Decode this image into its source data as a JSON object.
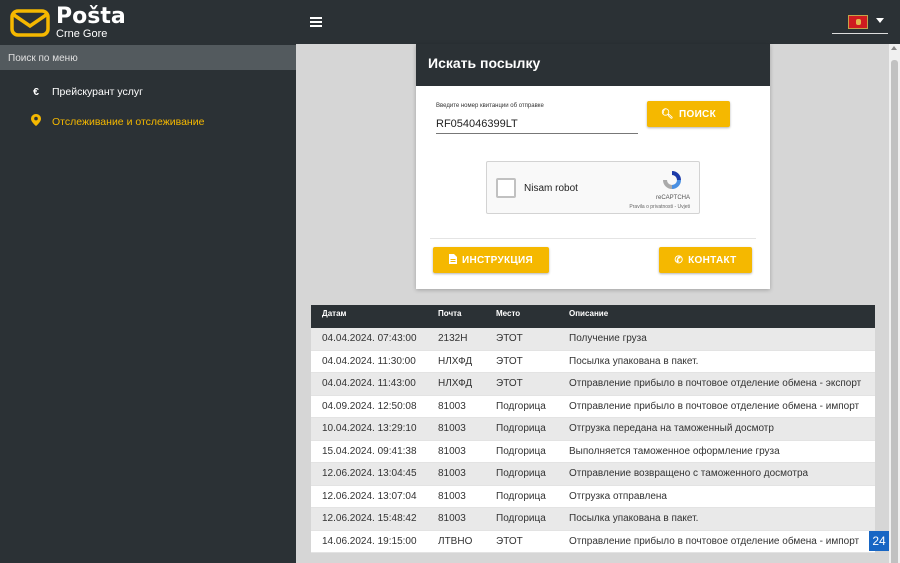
{
  "brand": {
    "title": "Pošta",
    "subtitle": "Crne Gore"
  },
  "sidebar": {
    "search_label": "Поиск по меню",
    "items": [
      {
        "label": "Прейскурант услуг",
        "icon": "euro-icon"
      },
      {
        "label": "Отслеживание и отслеживание",
        "icon": "location-pin-icon",
        "active": true
      }
    ]
  },
  "topbar": {
    "language": "flag-montenegro-icon"
  },
  "search": {
    "title": "Искать посылку",
    "field_label": "Введите номер квитанции об отправке",
    "tracking_number": "RF054046399LT",
    "search_button": "ПОИСК",
    "captcha_label": "Nisam robot",
    "captcha_brand": "reCAPTCHA",
    "captcha_links": "Pravila o privatnosti - Uvjeti",
    "instructions_button": "ИНСТРУКЦИЯ",
    "contact_button": "КОНТАКТ"
  },
  "table": {
    "headers": [
      "Датам",
      "Почта",
      "Место",
      "Описание"
    ],
    "rows": [
      [
        "04.04.2024. 07:43:00",
        "2132H",
        "ЭТОТ",
        "Получение груза"
      ],
      [
        "04.04.2024. 11:30:00",
        "НЛХФД",
        "ЭТОТ",
        "Посылка упакована в пакет."
      ],
      [
        "04.04.2024. 11:43:00",
        "НЛХФД",
        "ЭТОТ",
        "Отправление прибыло в почтовое отделение обмена - экспорт"
      ],
      [
        "04.09.2024. 12:50:08",
        "81003",
        "Подгорица",
        "Отправление прибыло в почтовое отделение обмена - импорт"
      ],
      [
        "10.04.2024. 13:29:10",
        "81003",
        "Подгорица",
        "Отгрузка передана на таможенный досмотр"
      ],
      [
        "15.04.2024. 09:41:38",
        "81003",
        "Подгорица",
        "Выполняется таможенное оформление груза"
      ],
      [
        "12.06.2024. 13:04:45",
        "81003",
        "Подгорица",
        "Отправление возвращено с таможенного досмотра"
      ],
      [
        "12.06.2024. 13:07:04",
        "81003",
        "Подгорица",
        "Отгрузка отправлена"
      ],
      [
        "12.06.2024. 15:48:42",
        "81003",
        "Подгорица",
        "Посылка упакована в пакет."
      ],
      [
        "14.06.2024. 19:15:00",
        "ЛТВНО",
        "ЭТОТ",
        "Отправление прибыло в почтовое отделение обмена - импорт"
      ]
    ]
  },
  "badge": "24",
  "colors": {
    "dark": "#2b3135",
    "accent": "#f5b800",
    "badge": "#1766c4"
  }
}
